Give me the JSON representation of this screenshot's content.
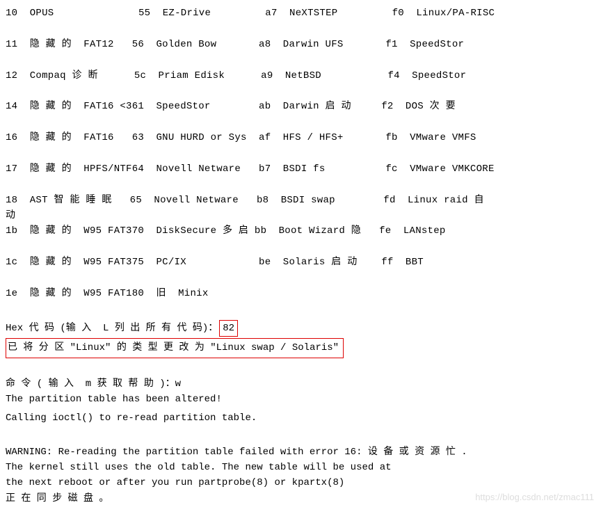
{
  "table_rows": [
    [
      [
        "10",
        "OPUS"
      ],
      [
        "55",
        "EZ-Drive"
      ],
      [
        "a7",
        "NeXTSTEP"
      ],
      [
        "f0",
        "Linux/PA-RISC"
      ]
    ],
    [
      [
        "11",
        "隐 藏 的  FAT12"
      ],
      [
        "56",
        "Golden Bow"
      ],
      [
        "a8",
        "Darwin UFS"
      ],
      [
        "f1",
        "SpeedStor"
      ]
    ],
    [
      [
        "12",
        "Compaq 诊 断"
      ],
      [
        "5c",
        "Priam Edisk"
      ],
      [
        "a9",
        "NetBSD"
      ],
      [
        "f4",
        "SpeedStor"
      ]
    ],
    [
      [
        "14",
        "隐 藏 的  FAT16 <3"
      ],
      [
        "61",
        "SpeedStor"
      ],
      [
        "ab",
        "Darwin 启 动"
      ],
      [
        "f2",
        "DOS 次 要"
      ]
    ],
    [
      [
        "16",
        "隐 藏 的  FAT16"
      ],
      [
        "63",
        "GNU HURD or Sys"
      ],
      [
        "af",
        "HFS / HFS+"
      ],
      [
        "fb",
        "VMware VMFS"
      ]
    ],
    [
      [
        "17",
        "隐 藏 的  HPFS/NTF"
      ],
      [
        "64",
        "Novell Netware"
      ],
      [
        "b7",
        "BSDI fs"
      ],
      [
        "fc",
        "VMware VMKCORE"
      ]
    ],
    [
      [
        "18",
        "AST 智 能 睡 眠"
      ],
      [
        "65",
        "Novell Netware"
      ],
      [
        "b8",
        "BSDI swap"
      ],
      [
        "fd",
        "Linux raid 自"
      ]
    ],
    [
      [
        "1b",
        "隐 藏 的  W95 FAT3"
      ],
      [
        "70",
        "DiskSecure 多 启"
      ],
      [
        "bb",
        "Boot Wizard 隐"
      ],
      [
        "fe",
        "LANstep"
      ]
    ],
    [
      [
        "1c",
        "隐 藏 的  W95 FAT3"
      ],
      [
        "75",
        "PC/IX"
      ],
      [
        "be",
        "Solaris 启 动"
      ],
      [
        "ff",
        "BBT"
      ]
    ],
    [
      [
        "1e",
        "隐 藏 的  W95 FAT1"
      ],
      [
        "80",
        "旧  Minix"
      ],
      [
        "",
        ""
      ],
      [
        "",
        ""
      ]
    ]
  ],
  "overflow_line": "动",
  "hex_prompt": "Hex 代 码 (输 入  L 列 出 所 有 代 码)：",
  "hex_value": "82",
  "change_msg": "已 将 分 区 \"Linux\" 的 类 型 更 改 为 \"Linux swap / Solaris\"",
  "cmd_prompt": "命 令 ( 输 入  m 获 取 帮 助 )：w",
  "altered_msg": "The partition table has been altered!",
  "calling_msg": "Calling ioctl() to re-read partition table.",
  "warning_l1": "WARNING: Re-reading the partition table failed with error 16: 设 备 或 资 源 忙 .",
  "warning_l2": "The kernel still uses the old table. The new table will be used at",
  "warning_l3": "the next reboot or after you run partprobe(8) or kpartx(8)",
  "sync_msg": "正 在 同 步 磁 盘 。",
  "watermark": "https://blog.csdn.net/zmac111"
}
